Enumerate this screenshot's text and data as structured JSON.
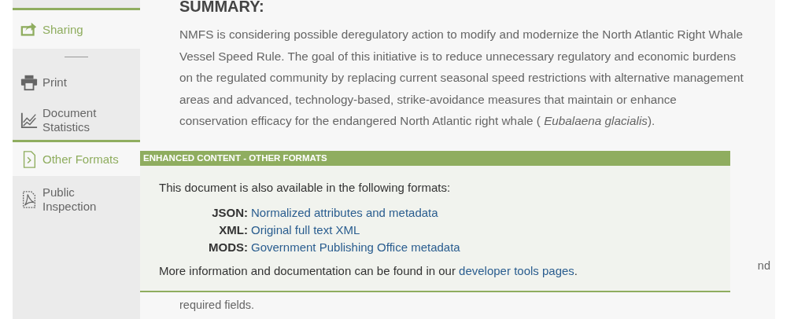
{
  "sidebar": {
    "items": [
      {
        "label": "Sharing",
        "kind": "share",
        "selected": true
      },
      {
        "kind": "divider"
      },
      {
        "label": "Print",
        "kind": "print",
        "selected": false
      },
      {
        "label": "Document Statistics",
        "kind": "chart",
        "selected": false
      },
      {
        "label": "Other Formats",
        "kind": "file",
        "selected": true
      },
      {
        "label": "Public Inspection",
        "kind": "pdf",
        "selected": false
      }
    ]
  },
  "main": {
    "heading": "SUMMARY:",
    "paragraph": "NMFS is considering possible deregulatory action to modify and modernize the North Atlantic Right Whale Vessel Speed Rule. The goal of this initiative is to reduce unnecessary regulatory and economic burdens on the regulated community by replacing current seasonal speed restrictions with alternative management areas and advanced, technology-based, strike-avoidance measures that maintain or enhance conservation efficacy for the endangered North Atlantic right whale ( *Eubalaena glacialis*).",
    "hidden_fragment": "nd",
    "last_line": "required fields."
  },
  "popup": {
    "title": "ENHANCED CONTENT - OTHER FORMATS",
    "intro": "This document is also available in the following formats:",
    "formats": [
      {
        "label": "JSON:",
        "link": "Normalized attributes and metadata"
      },
      {
        "label": "XML:",
        "link": "Original full text XML"
      },
      {
        "label": "MODS:",
        "link": "Government Publishing Office metadata"
      }
    ],
    "footer_text": "More information and documentation can be found in our",
    "footer_link": "developer tools pages",
    "footer_end": "."
  }
}
